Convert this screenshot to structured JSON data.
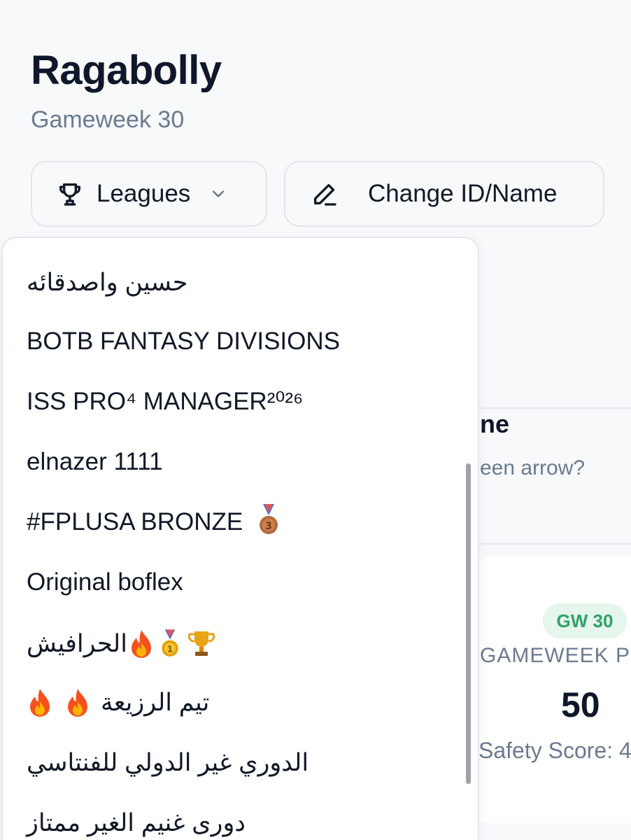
{
  "header": {
    "title": "Ragabolly",
    "subtitle": "Gameweek 30"
  },
  "toolbar": {
    "leagues_label": "Leagues",
    "change_label": "Change ID/Name"
  },
  "dropdown": {
    "items": [
      "حسين واصدقائه",
      "BOTB FANTASY DIVISIONS",
      "ISS PRO⁴ MANAGER²⁰²⁶",
      "elnazer 1111",
      "#FPLUSA BRONZE",
      "Original boflex",
      "الحرافيش",
      "تيم الرزيعة",
      "الدوري غير الدولي للفنتاسي",
      "دورى غنيم الغير ممتاز"
    ]
  },
  "background": {
    "card_heading": "ne",
    "card_sub": "een arrow?",
    "badge": "GW 30",
    "gameweek_label": "GAMEWEEK PO",
    "points": "50",
    "safety": "Safety Score: 4"
  },
  "colors": {
    "accent_green": "#2ea366",
    "badge_bg": "#e5f6ec",
    "muted_text": "#6b7a90",
    "border": "#e3e6ec"
  },
  "icons": [
    "trophy-icon",
    "chevron-down-icon",
    "pencil-icon",
    "fire-icon",
    "medal-icon"
  ]
}
